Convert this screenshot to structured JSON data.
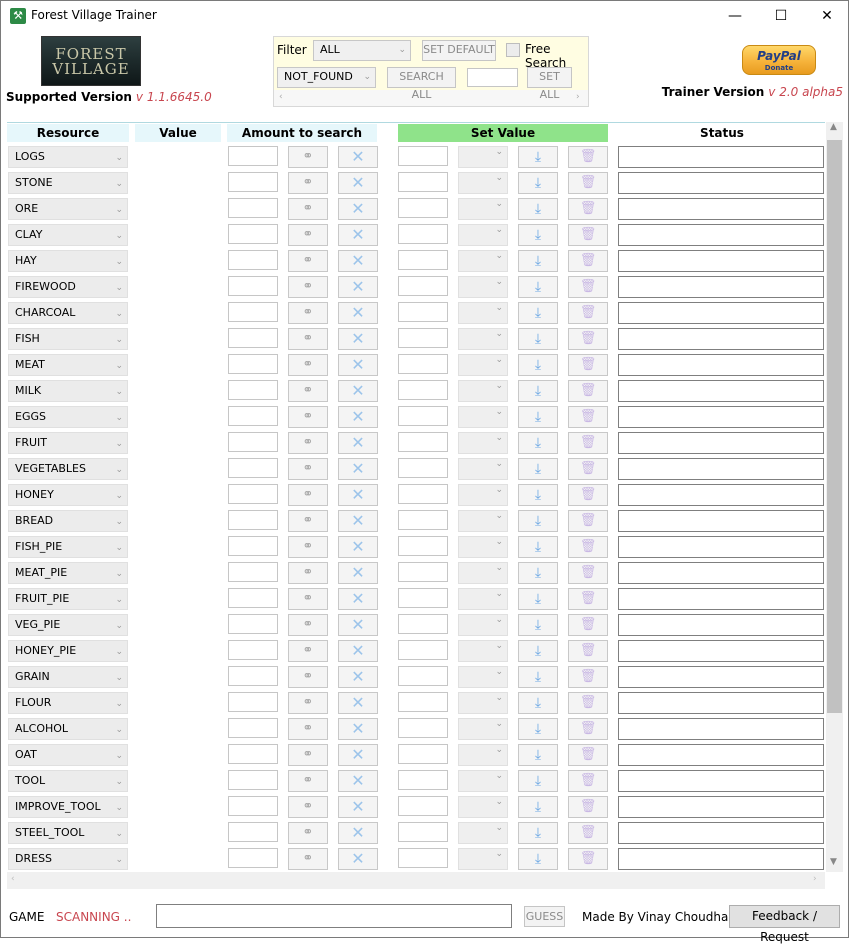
{
  "window": {
    "title": "Forest Village Trainer",
    "minimize": "—",
    "maximize": "☐",
    "close": "✕"
  },
  "header": {
    "logo_line1": "FOREST",
    "logo_line2": "VILLAGE",
    "supported_label": "Supported Version",
    "supported_version": "v 1.1.6645.0",
    "trainer_label": "Trainer Version",
    "trainer_version": "v 2.0 alpha5",
    "paypal_brand": "PayPal",
    "paypal_sub": "Donate"
  },
  "filter_panel": {
    "filter_label": "Filter",
    "filter_value": "ALL",
    "set_default": "SET DEFAULT",
    "free_search": "Free Search",
    "status_filter": "NOT_FOUND",
    "search_all": "SEARCH ALL",
    "set_all": "SET ALL"
  },
  "grid": {
    "headers": {
      "resource": "Resource",
      "value": "Value",
      "amount": "Amount to search",
      "set_value": "Set Value",
      "status": "Status"
    },
    "resources": [
      "LOGS",
      "STONE",
      "ORE",
      "CLAY",
      "HAY",
      "FIREWOOD",
      "CHARCOAL",
      "FISH",
      "MEAT",
      "MILK",
      "EGGS",
      "FRUIT",
      "VEGETABLES",
      "HONEY",
      "BREAD",
      "FISH_PIE",
      "MEAT_PIE",
      "FRUIT_PIE",
      "VEG_PIE",
      "HONEY_PIE",
      "GRAIN",
      "FLOUR",
      "ALCOHOL",
      "OAT",
      "TOOL",
      "IMPROVE_TOOL",
      "STEEL_TOOL",
      "DRESS"
    ]
  },
  "footer": {
    "game_label": "GAME",
    "game_status": "SCANNING ..",
    "guess": "GUESS",
    "made_by": "Made By Vinay Choudhary",
    "feedback": "Feedback / Request"
  },
  "colors": {
    "accent_red": "#c8464f",
    "set_value_header": "#8fe38a",
    "header_cell": "#e6f7fb",
    "panel_top": "#fffde2"
  },
  "icons": {
    "search": "binoculars-icon",
    "clear": "x-icon",
    "apply": "download-icon",
    "delete": "trash-icon"
  }
}
